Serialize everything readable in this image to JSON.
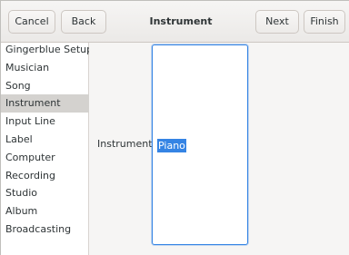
{
  "header": {
    "title": "Instrument",
    "cancel_label": "Cancel",
    "back_label": "Back",
    "next_label": "Next",
    "finish_label": "Finish"
  },
  "sidebar": {
    "items": [
      {
        "label": "Gingerblue Setup"
      },
      {
        "label": "Musician"
      },
      {
        "label": "Song"
      },
      {
        "label": "Instrument",
        "selected": true
      },
      {
        "label": "Input Line"
      },
      {
        "label": "Label"
      },
      {
        "label": "Computer"
      },
      {
        "label": "Recording"
      },
      {
        "label": "Studio"
      },
      {
        "label": "Album"
      },
      {
        "label": "Broadcasting"
      }
    ]
  },
  "main": {
    "field_label": "Instrument:",
    "options": [
      "Piano"
    ],
    "selected_option": "Piano"
  },
  "colors": {
    "accent": "#3584e4",
    "selected_sidebar": "#d4d2cf",
    "headerbar": "#ebe9e7"
  }
}
